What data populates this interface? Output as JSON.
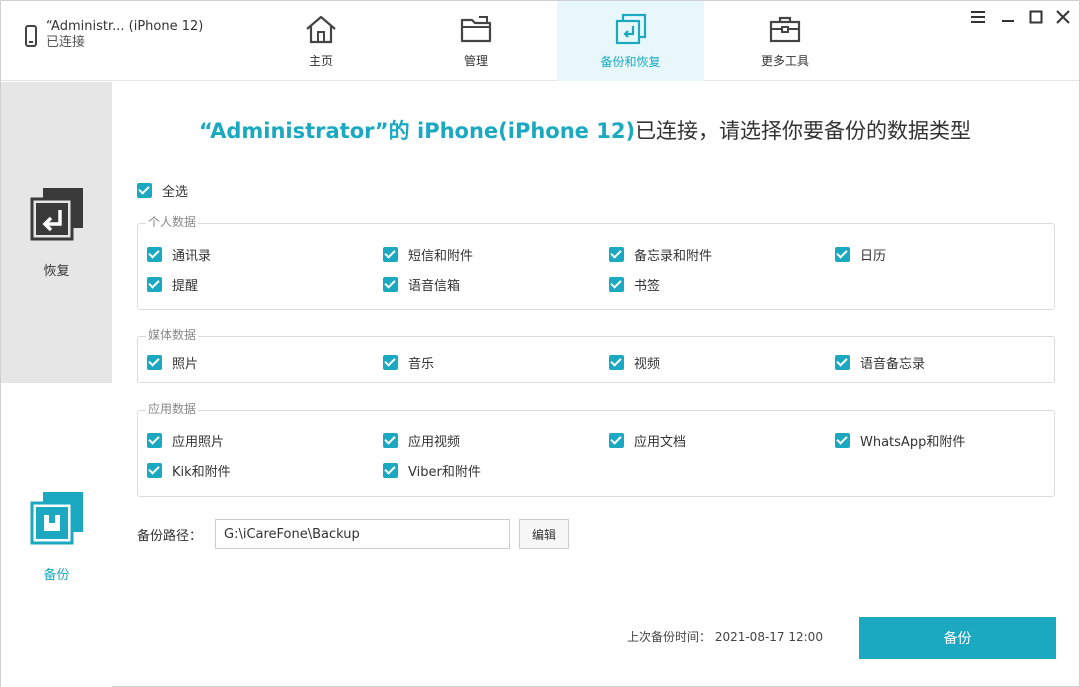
{
  "device": {
    "name": "“Administr... (iPhone 12)",
    "status": "已连接"
  },
  "nav": {
    "home": "主页",
    "manage": "管理",
    "backup_restore": "备份和恢复",
    "tools": "更多工具"
  },
  "sidebar": {
    "restore": "恢复",
    "backup": "备份"
  },
  "headline": {
    "highlight": "“Administrator”的 iPhone(iPhone 12)",
    "rest": "已连接，请选择你要备份的数据类型"
  },
  "select_all": "全选",
  "groups": {
    "personal": {
      "title": "个人数据",
      "items": [
        "通讯录",
        "短信和附件",
        "备忘录和附件",
        "日历",
        "提醒",
        "语音信箱",
        "书签"
      ]
    },
    "media": {
      "title": "媒体数据",
      "items": [
        "照片",
        "音乐",
        "视频",
        "语音备忘录"
      ]
    },
    "app": {
      "title": "应用数据",
      "items": [
        "应用照片",
        "应用视频",
        "应用文档",
        "WhatsApp和附件",
        "Kik和附件",
        "Viber和附件"
      ]
    }
  },
  "path": {
    "label": "备份路径：",
    "value": "G:\\iCareFone\\Backup",
    "edit": "编辑"
  },
  "last_backup": "上次备份时间： 2021-08-17 12:00",
  "backup_button": "备份",
  "colors": {
    "accent": "#1aa9c1",
    "sidebar_active": "#e6e6e6"
  }
}
